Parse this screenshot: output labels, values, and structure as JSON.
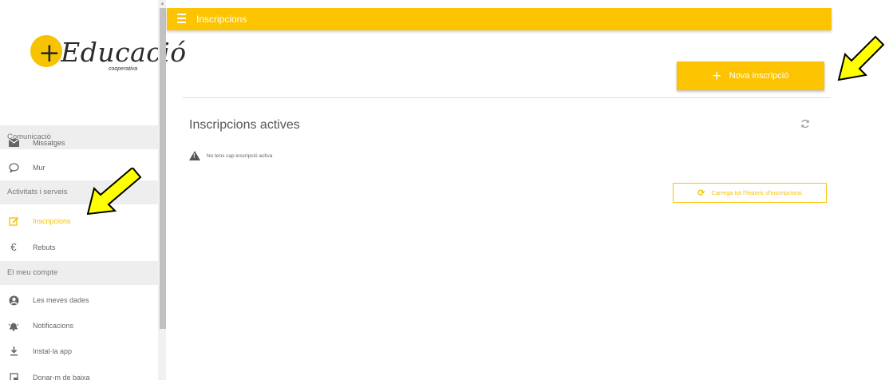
{
  "app": {
    "logo_text": "+Educació",
    "logo_sub": "cooperativa"
  },
  "sidebar": {
    "sections": [
      {
        "label": "Comunicació"
      },
      {
        "label": "Activitats i serveis"
      },
      {
        "label": "El meu compte"
      }
    ],
    "items": [
      {
        "label": "Missatges",
        "icon": "envelope-icon"
      },
      {
        "label": "Mur",
        "icon": "chat-bubble-icon"
      },
      {
        "label": "Inscripcions",
        "icon": "edit-icon",
        "active": true
      },
      {
        "label": "Rebuts",
        "icon": "euro-icon"
      },
      {
        "label": "Les meves dades",
        "icon": "user-circle-icon"
      },
      {
        "label": "Notificacions",
        "icon": "bell-icon"
      },
      {
        "label": "Instal·la app",
        "icon": "download-icon"
      },
      {
        "label": "Donar-m de baixa",
        "icon": "document-icon"
      }
    ]
  },
  "header": {
    "title": "Inscripcions"
  },
  "main": {
    "new_button_label": "Nova inscripció",
    "section_title": "Inscripcions actives",
    "empty_message": "No tens cap inscripció activa",
    "history_button_label": "Carrega tot l'historic d'inscripcions"
  },
  "colors": {
    "accent": "#fcc400",
    "annotation_arrow": "#ffff00"
  }
}
